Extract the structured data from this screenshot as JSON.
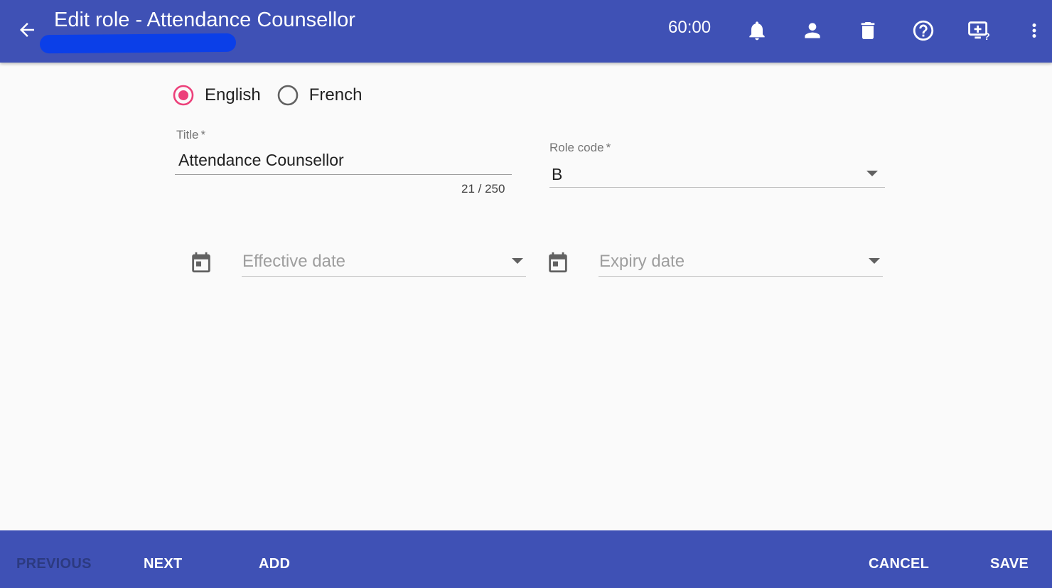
{
  "header": {
    "title": "Edit role - Attendance Counsellor",
    "timer": "60:00",
    "icons": [
      "arrow-back-icon",
      "bell-icon",
      "person-icon",
      "trash-icon",
      "help-icon",
      "screen-help-icon",
      "more-vert-icon"
    ],
    "bar_color": "#3f51b5"
  },
  "language": {
    "options": [
      "English",
      "French"
    ],
    "selected": "English",
    "accent": "#ec407a"
  },
  "form": {
    "title": {
      "label": "Title",
      "required": "*",
      "value": "Attendance Counsellor",
      "counter": "21 / 250"
    },
    "role_code": {
      "label": "Role code",
      "required": "*",
      "value": "B"
    },
    "effective_date": {
      "placeholder": "Effective date"
    },
    "expiry_date": {
      "placeholder": "Expiry date"
    }
  },
  "footer": {
    "previous": "PREVIOUS",
    "next": "NEXT",
    "add": "ADD",
    "cancel": "CANCEL",
    "save": "SAVE"
  }
}
